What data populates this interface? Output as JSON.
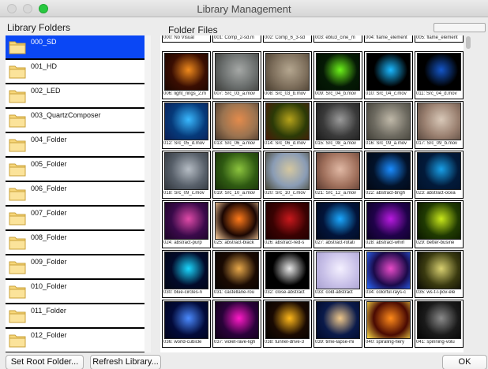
{
  "window": {
    "title": "Library Management"
  },
  "library_panel": {
    "label": "Library Folders"
  },
  "files_panel": {
    "label": "Folder Files"
  },
  "folders": [
    "000_SD",
    "001_HD",
    "002_LED",
    "003_QuartzComposer",
    "004_Folder",
    "005_Folder",
    "006_Folder",
    "007_Folder",
    "008_Folder",
    "009_Folder",
    "010_Folder",
    "011_Folder",
    "012_Folder"
  ],
  "selected_folder": "000_SD",
  "top_row_files": [
    "000: No Visual",
    "001: Comp_2-sd.m",
    "002: Comp_6_3-sd",
    "003: eblu3_cine_m",
    "004: flame_element",
    "005: flame_element"
  ],
  "files": [
    {
      "label": "006: light_rings_2.m",
      "colors": [
        "#3a0e02",
        "#f08a1c",
        "#1a0600"
      ]
    },
    {
      "label": "007: Src_03_a.mov",
      "colors": [
        "#6b6f6e",
        "#a5a8a6",
        "#3c3d3a"
      ]
    },
    {
      "label": "008: Src_03_b.mov",
      "colors": [
        "#7e6f5c",
        "#b4a68f",
        "#4a3e30"
      ]
    },
    {
      "label": "009: Src_04_b.mov",
      "colors": [
        "#051a05",
        "#6cf21a",
        "#021002"
      ]
    },
    {
      "label": "010: Src_04_c.mov",
      "colors": [
        "#000000",
        "#1ab8ff",
        "#000000"
      ]
    },
    {
      "label": "011: Src_04_d.mov",
      "colors": [
        "#000000",
        "#1456c8",
        "#000000"
      ]
    },
    {
      "label": "012: Src_05_d.mov",
      "colors": [
        "#063a7a",
        "#39b9ff",
        "#0b1e56"
      ]
    },
    {
      "label": "013: Src_06_a.mov",
      "colors": [
        "#9a7350",
        "#e38b4c",
        "#4a3a2e"
      ]
    },
    {
      "label": "014: Src_06_d.mov",
      "colors": [
        "#2b3a07",
        "#b5a21a",
        "#4a1a09"
      ]
    },
    {
      "label": "015: Src_08_a.mov",
      "colors": [
        "#3a3a3a",
        "#9a9a9a",
        "#1c1c1c"
      ]
    },
    {
      "label": "016: Src_09_a.mov",
      "colors": [
        "#6d6a60",
        "#bfb8a8",
        "#424038"
      ]
    },
    {
      "label": "017: Src_09_b.mov",
      "colors": [
        "#9a8070",
        "#d8c8b8",
        "#5b4a40"
      ]
    },
    {
      "label": "018: Src_09_c.mov",
      "colors": [
        "#58606a",
        "#b5bcc4",
        "#30353c"
      ]
    },
    {
      "label": "019: Src_10_a.mov",
      "colors": [
        "#2f5a12",
        "#8cc43e",
        "#183008"
      ]
    },
    {
      "label": "020: Src_10_c.mov",
      "colors": [
        "#8a9cb5",
        "#d4c7a0",
        "#4a4a3a"
      ]
    },
    {
      "label": "021: Src_12_a.mov",
      "colors": [
        "#a0705c",
        "#e0b8a4",
        "#5a3a30"
      ]
    },
    {
      "label": "022: abstract-brigh",
      "colors": [
        "#02122a",
        "#1a8cff",
        "#020814"
      ]
    },
    {
      "label": "023: abstract-ocea",
      "colors": [
        "#021a3a",
        "#18a0e8",
        "#01122a"
      ]
    },
    {
      "label": "024: abstract-purp",
      "colors": [
        "#3a0a4a",
        "#e04aa8",
        "#1a0424"
      ]
    },
    {
      "label": "025: abstract-black",
      "colors": [
        "#1a0602",
        "#ff7a1a",
        "#ffd2a0"
      ]
    },
    {
      "label": "026: abstract-red-s",
      "colors": [
        "#3a0202",
        "#c8181c",
        "#1a0000"
      ]
    },
    {
      "label": "027: abstract-rotati",
      "colors": [
        "#02143a",
        "#1aa8ff",
        "#020a1e"
      ]
    },
    {
      "label": "028: abstract-whirl",
      "colors": [
        "#20024a",
        "#b81ae0",
        "#0a0124"
      ]
    },
    {
      "label": "029: better-busine",
      "colors": [
        "#203a02",
        "#c8e81a",
        "#0a1600"
      ]
    },
    {
      "label": "030: blue-circles-n",
      "colors": [
        "#020a2a",
        "#1ad8ff",
        "#010614"
      ]
    },
    {
      "label": "031: castellane-rou",
      "colors": [
        "#1a0a02",
        "#e8a84a",
        "#080402"
      ]
    },
    {
      "label": "032: close-abstract",
      "colors": [
        "#000000",
        "#e8e8e8",
        "#000000"
      ]
    },
    {
      "label": "033: cold-abstract",
      "colors": [
        "#c8c0e8",
        "#f4f0ff",
        "#a8a0d0"
      ]
    },
    {
      "label": "034: colorful-rays-c",
      "colors": [
        "#1a0a4a",
        "#e84ac8",
        "#2a6aff"
      ]
    },
    {
      "label": "035: ws-t-l-pov-ele",
      "colors": [
        "#3a3a10",
        "#d8d070",
        "#0a0a04"
      ]
    },
    {
      "label": "036: world-cubicle",
      "colors": [
        "#020a3a",
        "#4a8aff",
        "#02041a"
      ]
    },
    {
      "label": "037: violet-rave-ligh",
      "colors": [
        "#2a023a",
        "#ff1ac8",
        "#100118"
      ]
    },
    {
      "label": "038: tunnel-drive-3",
      "colors": [
        "#1a0a02",
        "#ffb81a",
        "#040200"
      ]
    },
    {
      "label": "039: time-lapse-mi",
      "colors": [
        "#0a1a4a",
        "#f0c88a",
        "#020a2a"
      ]
    },
    {
      "label": "040: spiraling-fiery",
      "colors": [
        "#4a0a02",
        "#ff8a1a",
        "#ffe04a"
      ]
    },
    {
      "label": "041: spinning-volu",
      "colors": [
        "#1a1a1a",
        "#8a8a8a",
        "#050505"
      ]
    }
  ],
  "buttons": {
    "set_root": "Set Root Folder...",
    "refresh": "Refresh Library...",
    "ok": "OK"
  }
}
